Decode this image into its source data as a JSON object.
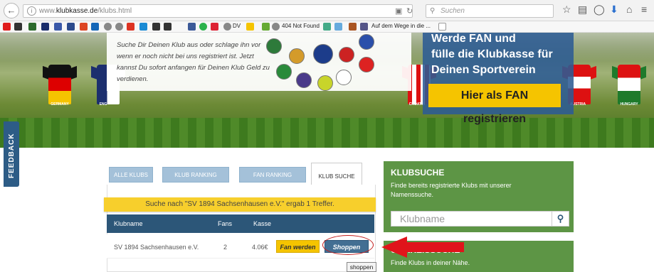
{
  "browser": {
    "url_prefix": "www.",
    "url_domain": "klubkasse.de",
    "url_path": "/klubs.html",
    "search_placeholder": "Suchen",
    "bookmarks": [
      "DV",
      "404 Not Found",
      "Auf dem Wege in die ..."
    ]
  },
  "hero": {
    "intro_text": "Suche Dir Deinen Klub aus oder schlage ihn vor wenn er noch nicht bei uns registriert ist. Jetzt kannst Du sofort anfangen für Deinen Klub Geld zu verdienen.",
    "fan_heading_1": "Werde FAN und",
    "fan_heading_2": "fülle die Klubkasse für",
    "fan_heading_3": "Deinen Sportverein",
    "fan_button": "Hier als FAN registrieren",
    "jerseys": [
      "GERMANY",
      "ENG",
      "CROATIA",
      "AUSTRIA",
      "HUNGARY"
    ]
  },
  "feedback_label": "FEEDBACK",
  "tabs": [
    "ALLE KLUBS",
    "KLUB RANKING",
    "FAN RANKING",
    "KLUB SUCHE"
  ],
  "notice": "Suche nach \"SV 1894 Sachsenhausen e.V.\" ergab 1 Treffer.",
  "table": {
    "headers": [
      "Klubname",
      "Fans",
      "Kasse"
    ],
    "row": {
      "name": "SV 1894 Sachsenhausen e.V.",
      "fans": "2",
      "kasse": "4.06€",
      "fan_btn": "Fan werden",
      "shop_btn": "Shoppen"
    }
  },
  "tooltip": "shoppen",
  "klubsuche": {
    "title": "KLUBSUCHE",
    "desc": "Finde bereits registrierte Klubs mit unserer Namenssuche.",
    "placeholder": "Klubname"
  },
  "umkreis": {
    "title": "UMKREISSUCHE",
    "desc": "Finde Klubs in deiner Nähe."
  },
  "colors": {
    "navy": "#2c5678",
    "gold": "#f5c400",
    "green": "#5d9545",
    "arrow_red": "#e0141b"
  }
}
